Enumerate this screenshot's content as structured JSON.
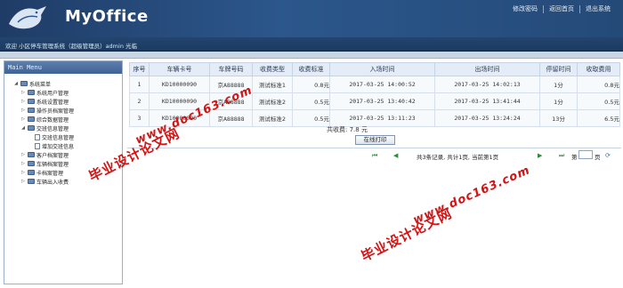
{
  "header": {
    "logo_text": "MyOffice",
    "links": [
      "修改密码",
      "返回首页",
      "退出系统"
    ],
    "welcome": "欢迎 小区停车管理系统（超级管理员）admin 光临"
  },
  "sidebar": {
    "title": "Main Menu",
    "tree": [
      {
        "label": "系统菜单",
        "level": 0,
        "expanded": true,
        "type": "folder"
      },
      {
        "label": "系统用户管理",
        "level": 1,
        "expanded": false,
        "type": "folder"
      },
      {
        "label": "系统设置管理",
        "level": 1,
        "expanded": false,
        "type": "folder"
      },
      {
        "label": "操作员档案管理",
        "level": 1,
        "expanded": false,
        "type": "folder"
      },
      {
        "label": "综合数据管理",
        "level": 1,
        "expanded": false,
        "type": "folder"
      },
      {
        "label": "交班信息管理",
        "level": 1,
        "expanded": true,
        "type": "folder"
      },
      {
        "label": "交班信息管理",
        "level": 2,
        "expanded": false,
        "type": "page"
      },
      {
        "label": "增加交班信息",
        "level": 2,
        "expanded": false,
        "type": "page"
      },
      {
        "label": "客户档案管理",
        "level": 1,
        "expanded": false,
        "type": "folder"
      },
      {
        "label": "车辆档案管理",
        "level": 1,
        "expanded": false,
        "type": "folder"
      },
      {
        "label": "卡档案管理",
        "level": 1,
        "expanded": false,
        "type": "folder"
      },
      {
        "label": "车辆出入收费",
        "level": 1,
        "expanded": false,
        "type": "folder"
      }
    ]
  },
  "table": {
    "columns": [
      "序号",
      "车辆卡号",
      "车牌号码",
      "收费类型",
      "收费标准",
      "入场时间",
      "出场时间",
      "停留时间",
      "收取费用"
    ],
    "rows": [
      [
        "1",
        "KD10000090",
        "京A88888",
        "测试标准1",
        "0.8元",
        "2017-03-25 14:00:52",
        "2017-03-25 14:02:13",
        "1分",
        "0.8元"
      ],
      [
        "2",
        "KD10000090",
        "京A88888",
        "测试标准2",
        "0.5元",
        "2017-03-25 13:40:42",
        "2017-03-25 13:41:44",
        "1分",
        "0.5元"
      ],
      [
        "3",
        "KD10000090",
        "京A88888",
        "测试标准2",
        "0.5元",
        "2017-03-25 13:11:23",
        "2017-03-25 13:24:24",
        "13分",
        "6.5元"
      ]
    ],
    "total": "共收费: 7.8 元",
    "print_label": "在线打印"
  },
  "pager": {
    "first": "⏮",
    "prev": "◀",
    "info": "共3条记录, 共计1页, 当前第1页",
    "next": "▶",
    "last": "⏭",
    "goto_prefix": "第",
    "goto_suffix": "页",
    "refresh": "⟳"
  },
  "watermarks": {
    "cn": "毕业设计论文网",
    "url": "www.doc163.com"
  },
  "colors": {
    "header_bg": "#2c578c",
    "watermark": "#d21414",
    "pager_green": "#2e8a3a"
  }
}
